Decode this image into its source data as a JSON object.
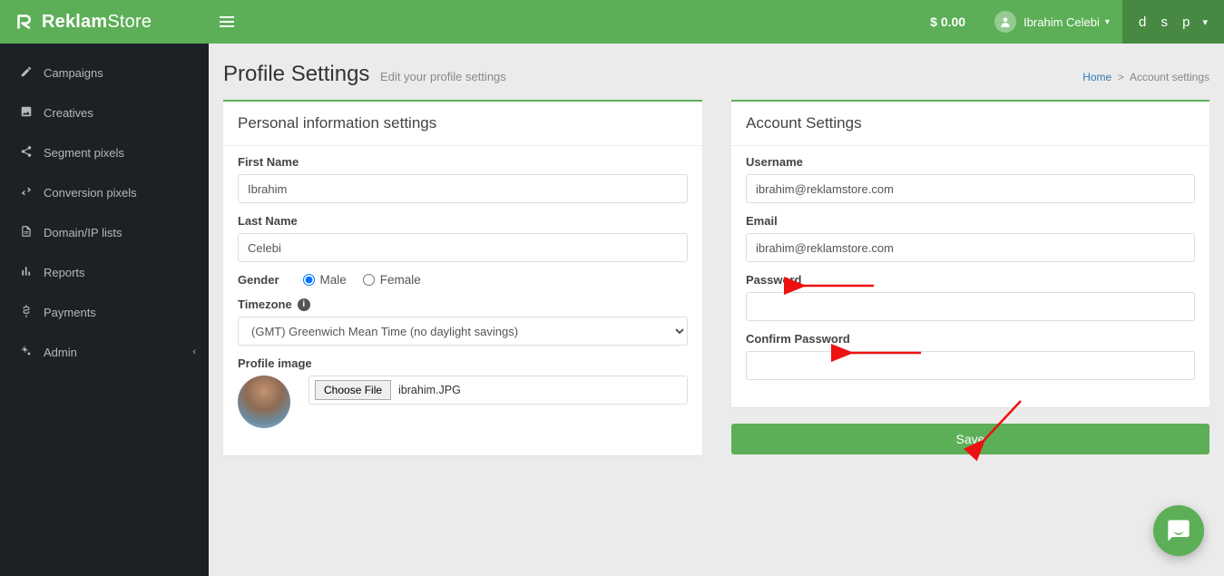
{
  "header": {
    "brand_prefix": "Reklam",
    "brand_suffix": "Store",
    "balance": "$  0.00",
    "username": "Ibrahim Celebi",
    "switcher": "d s p"
  },
  "sidebar": {
    "items": [
      {
        "label": "Campaigns"
      },
      {
        "label": "Creatives"
      },
      {
        "label": "Segment pixels"
      },
      {
        "label": "Conversion pixels"
      },
      {
        "label": "Domain/IP lists"
      },
      {
        "label": "Reports"
      },
      {
        "label": "Payments"
      },
      {
        "label": "Admin"
      }
    ]
  },
  "page": {
    "title": "Profile Settings",
    "subtitle": "Edit your profile settings",
    "breadcrumb_home": "Home",
    "breadcrumb_sep": ">",
    "breadcrumb_current": "Account settings"
  },
  "personal": {
    "panel_title": "Personal information settings",
    "first_name_label": "First Name",
    "first_name_value": "Ibrahim",
    "last_name_label": "Last Name",
    "last_name_value": "Celebi",
    "gender_label": "Gender",
    "gender_options": {
      "male": "Male",
      "female": "Female"
    },
    "gender_selected": "male",
    "timezone_label": "Timezone",
    "timezone_value": "(GMT) Greenwich Mean Time (no daylight savings)",
    "profile_image_label": "Profile image",
    "choose_file_label": "Choose File",
    "profile_image_filename": "ibrahim.JPG"
  },
  "account": {
    "panel_title": "Account Settings",
    "username_label": "Username",
    "username_value": "ibrahim@reklamstore.com",
    "email_label": "Email",
    "email_value": "ibrahim@reklamstore.com",
    "password_label": "Password",
    "password_value": "",
    "confirm_password_label": "Confirm Password",
    "confirm_password_value": "",
    "save_label": "Save"
  },
  "colors": {
    "brand_green": "#5caf57",
    "sidebar_bg": "#1c2125"
  }
}
